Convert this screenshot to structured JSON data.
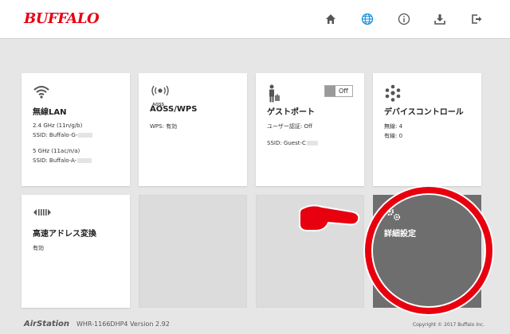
{
  "header": {
    "logo": "BUFFALO",
    "icons": [
      "home-icon",
      "globe-icon",
      "info-icon",
      "download-icon",
      "logout-icon"
    ]
  },
  "cards": {
    "wireless": {
      "title": "無線LAN",
      "band24": "2.4 GHz (11n/g/b)",
      "ssid24": "SSID: Buffalo-G-",
      "band5": "5 GHz (11ac/n/a)",
      "ssid5": "SSID: Buffalo-A-"
    },
    "aoss": {
      "title": "AOSS/WPS",
      "icon_label": "AOSS",
      "status": "WPS: 有効"
    },
    "guest": {
      "title": "ゲストポート",
      "toggle": "Off",
      "auth": "ユーザー認証: Off",
      "ssid": "SSID: Guest-C"
    },
    "device": {
      "title": "デバイスコントロール",
      "wireless_count": "無線: 4",
      "wired_count": "有線: 0"
    },
    "speed": {
      "title": "高速アドレス変換",
      "status": "有効"
    },
    "advanced": {
      "title": "詳細設定"
    }
  },
  "footer": {
    "brand": "AirStation",
    "model": "WHR-1166DHP4 Version 2.92",
    "copyright": "Copyright © 2017 Buffalo Inc."
  },
  "colors": {
    "brand": "#e60012",
    "accent": "#1a8fd6",
    "highlight": "#e8000f"
  }
}
